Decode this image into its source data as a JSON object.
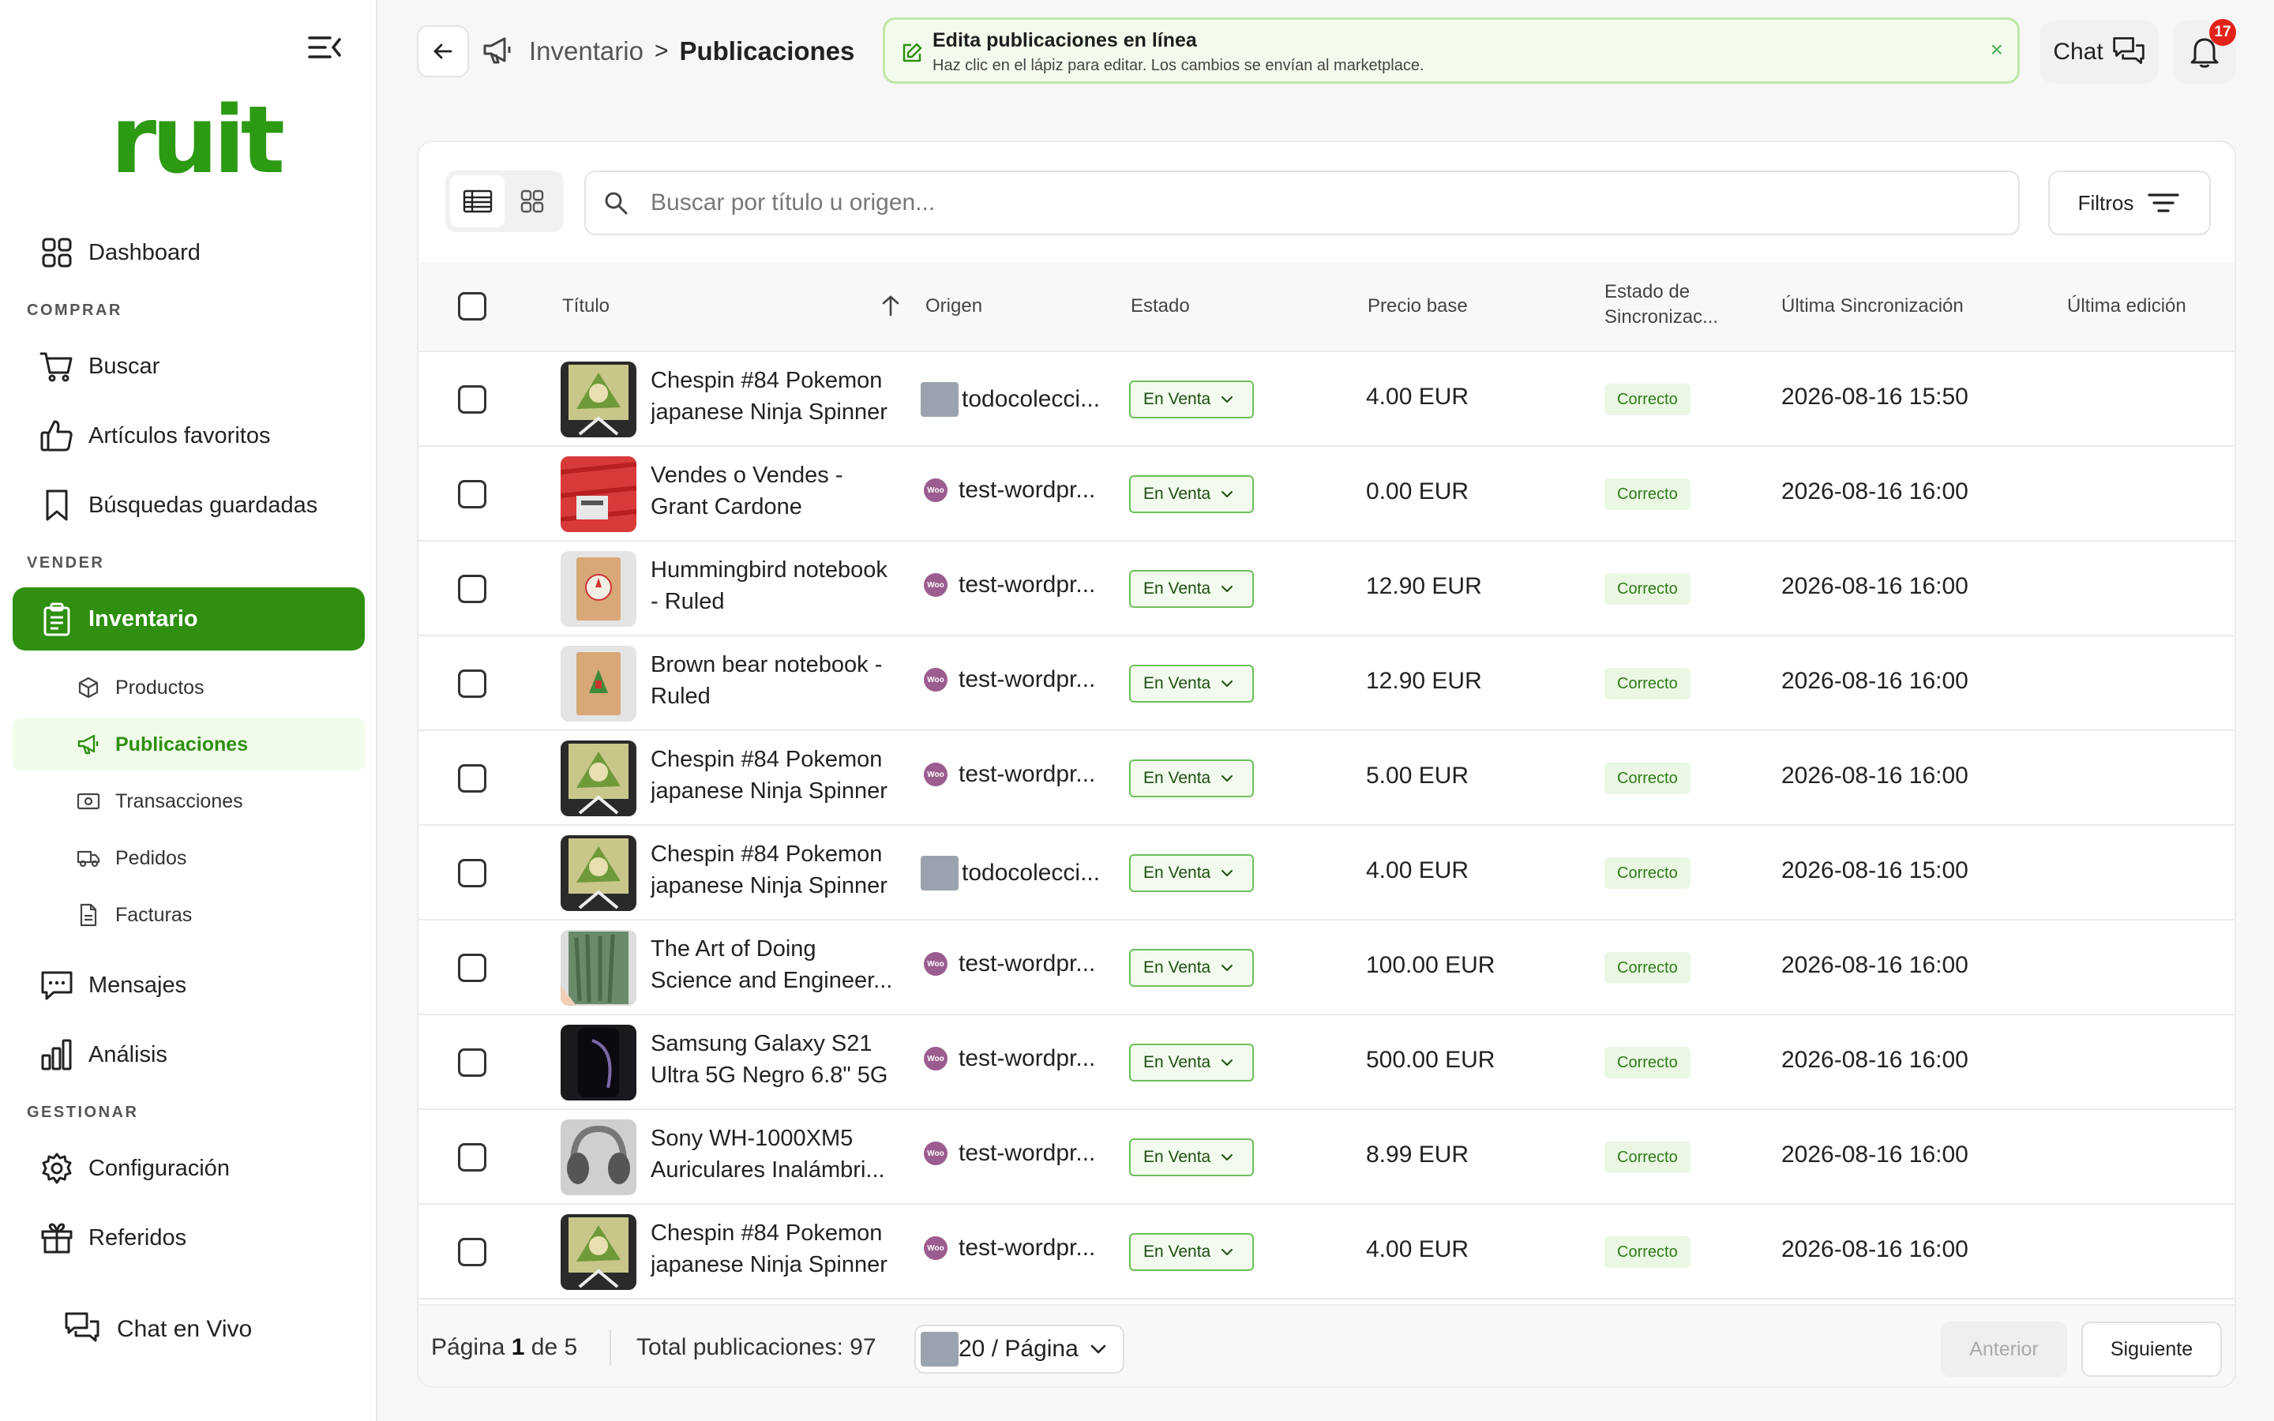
{
  "sidebar": {
    "logo": "ruit",
    "dashboard": "Dashboard",
    "section_comprar": "COMPRAR",
    "buscar": "Buscar",
    "favoritos": "Artículos favoritos",
    "busquedas": "Búsquedas guardadas",
    "section_vender": "VENDER",
    "inventario": "Inventario",
    "productos": "Productos",
    "publicaciones": "Publicaciones",
    "transacciones": "Transacciones",
    "pedidos": "Pedidos",
    "facturas": "Facturas",
    "mensajes": "Mensajes",
    "analisis": "Análisis",
    "section_gestionar": "GESTIONAR",
    "configuracion": "Configuración",
    "referidos": "Referidos",
    "chat_en_vivo": "Chat en Vivo"
  },
  "header": {
    "breadcrumb_parent": "Inventario",
    "breadcrumb_sep": ">",
    "breadcrumb_current": "Publicaciones",
    "banner_title": "Edita publicaciones en línea",
    "banner_subtitle": "Haz clic en el lápiz para editar. Los cambios se envían al marketplace.",
    "banner_close": "×",
    "chat_label": "Chat",
    "notification_count": "17"
  },
  "toolbar": {
    "search_placeholder": "Buscar por título u origen...",
    "filters_label": "Filtros"
  },
  "table": {
    "columns": {
      "titulo": "Título",
      "origen": "Origen",
      "estado": "Estado",
      "precio": "Precio base",
      "estado_sync_1": "Estado de",
      "estado_sync_2": "Sincronizac...",
      "ultima_sync": "Última Sincronización",
      "ultima_edicion": "Última edición"
    },
    "rows": [
      {
        "t1": "Chespin #84 Pokemon",
        "t2": "japanese Ninja Spinner",
        "origin": "todocolecci...",
        "origin_type": "square",
        "thumb": "pokemon",
        "status": "En Venta",
        "price": "4.00 EUR",
        "sync": "Correcto",
        "time": "2026-08-16 15:50"
      },
      {
        "t1": "Vendes o Vendes -",
        "t2": "Grant Cardone",
        "origin": "test-wordpr...",
        "origin_type": "woo",
        "thumb": "red",
        "status": "En Venta",
        "price": "0.00 EUR",
        "sync": "Correcto",
        "time": "2026-08-16 16:00"
      },
      {
        "t1": "Hummingbird notebook",
        "t2": "- Ruled",
        "origin": "test-wordpr...",
        "origin_type": "woo",
        "thumb": "notebook-bird",
        "status": "En Venta",
        "price": "12.90 EUR",
        "sync": "Correcto",
        "time": "2026-08-16 16:00"
      },
      {
        "t1": "Brown bear notebook -",
        "t2": "Ruled",
        "origin": "test-wordpr...",
        "origin_type": "woo",
        "thumb": "notebook-bear",
        "status": "En Venta",
        "price": "12.90 EUR",
        "sync": "Correcto",
        "time": "2026-08-16 16:00"
      },
      {
        "t1": "Chespin #84 Pokemon",
        "t2": "japanese Ninja Spinner",
        "origin": "test-wordpr...",
        "origin_type": "woo",
        "thumb": "pokemon",
        "status": "En Venta",
        "price": "5.00 EUR",
        "sync": "Correcto",
        "time": "2026-08-16 16:00"
      },
      {
        "t1": "Chespin #84 Pokemon",
        "t2": "japanese Ninja Spinner",
        "origin": "todocolecci...",
        "origin_type": "square",
        "thumb": "pokemon",
        "status": "En Venta",
        "price": "4.00 EUR",
        "sync": "Correcto",
        "time": "2026-08-16 15:00"
      },
      {
        "t1": "The Art of Doing",
        "t2": "Science and Engineer...",
        "origin": "test-wordpr...",
        "origin_type": "woo",
        "thumb": "book-green",
        "status": "En Venta",
        "price": "100.00 EUR",
        "sync": "Correcto",
        "time": "2026-08-16 16:00"
      },
      {
        "t1": "Samsung Galaxy S21",
        "t2": "Ultra 5G Negro 6.8\" 5G",
        "origin": "test-wordpr...",
        "origin_type": "woo",
        "thumb": "phone",
        "status": "En Venta",
        "price": "500.00 EUR",
        "sync": "Correcto",
        "time": "2026-08-16 16:00"
      },
      {
        "t1": "Sony WH-1000XM5",
        "t2": "Auriculares Inalámbri...",
        "origin": "test-wordpr...",
        "origin_type": "woo",
        "thumb": "headphones",
        "status": "En Venta",
        "price": "8.99 EUR",
        "sync": "Correcto",
        "time": "2026-08-16 16:00"
      },
      {
        "t1": "Chespin #84 Pokemon",
        "t2": "japanese Ninja Spinner",
        "origin": "test-wordpr...",
        "origin_type": "woo",
        "thumb": "pokemon",
        "status": "En Venta",
        "price": "4.00 EUR",
        "sync": "Correcto",
        "time": "2026-08-16 16:00"
      }
    ]
  },
  "footer": {
    "page_label": "Página",
    "page_current": "1",
    "page_of": "de 5",
    "total_label": "Total publicaciones: 97",
    "per_page": "20 / Página",
    "prev": "Anterior",
    "next": "Siguiente"
  },
  "colors": {
    "brand": "#2e8f10",
    "woo": "#9b5c8f",
    "badge": "#e2231a"
  }
}
